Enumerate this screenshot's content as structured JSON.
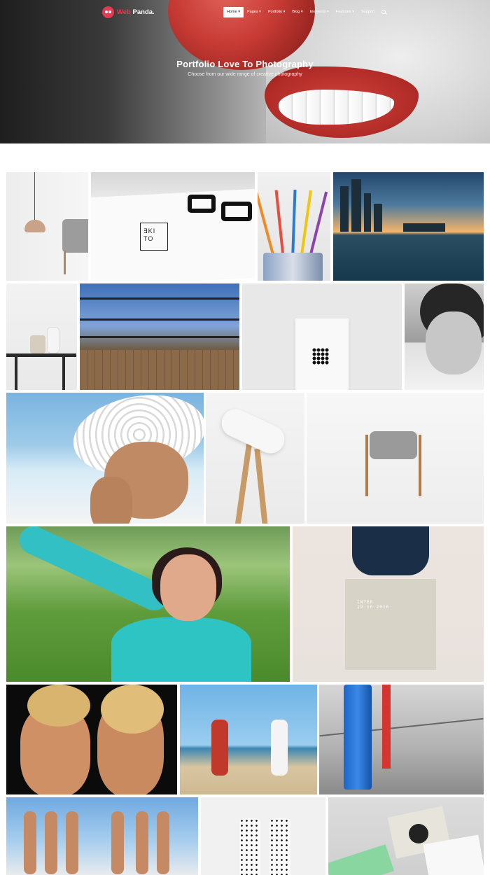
{
  "header": {
    "logo": {
      "brand_primary": "Web",
      "brand_secondary": " Panda.",
      "icon": "panda-icon"
    },
    "nav": [
      {
        "label": "Home ▾",
        "active": true
      },
      {
        "label": "Pages ▾",
        "active": false
      },
      {
        "label": "Portfolio ▾",
        "active": false
      },
      {
        "label": "Blog ▾",
        "active": false
      },
      {
        "label": "Elements ▾",
        "active": false
      },
      {
        "label": "Features ▾",
        "active": false
      },
      {
        "label": "Support",
        "active": false
      }
    ],
    "search_icon": "search-icon"
  },
  "hero": {
    "title": "Portfolio Love To Photography",
    "subtitle": "Choose from our wide range of creative photography"
  },
  "gallery": {
    "items": [
      {
        "subject": "pendant lamp and armchair"
      },
      {
        "subject": "business card with eyeglasses",
        "card_text": "∃KI TO"
      },
      {
        "subject": "paint brushes in a jar"
      },
      {
        "subject": "city skyline at sunset"
      },
      {
        "subject": "vase on side table"
      },
      {
        "subject": "pier with railing"
      },
      {
        "subject": "dotted card mockup"
      },
      {
        "subject": "woman with glasses"
      },
      {
        "subject": "woman in sun hat"
      },
      {
        "subject": "desk lamp"
      },
      {
        "subject": "wooden armchair"
      },
      {
        "subject": "laughing woman in field"
      },
      {
        "subject": "tote bag mockup",
        "bag_text": [
          "INTER",
          "19.10.2016"
        ]
      },
      {
        "subject": "two women in bikinis"
      },
      {
        "subject": "high-five on beach"
      },
      {
        "subject": "clothespins"
      },
      {
        "subject": "group on beach"
      },
      {
        "subject": "bottle mockups"
      },
      {
        "subject": "stationery mockup"
      }
    ]
  },
  "colors": {
    "accent": "#e23a52",
    "nav_text": "#ffffff",
    "nav_active_bg": "#ffffff"
  }
}
